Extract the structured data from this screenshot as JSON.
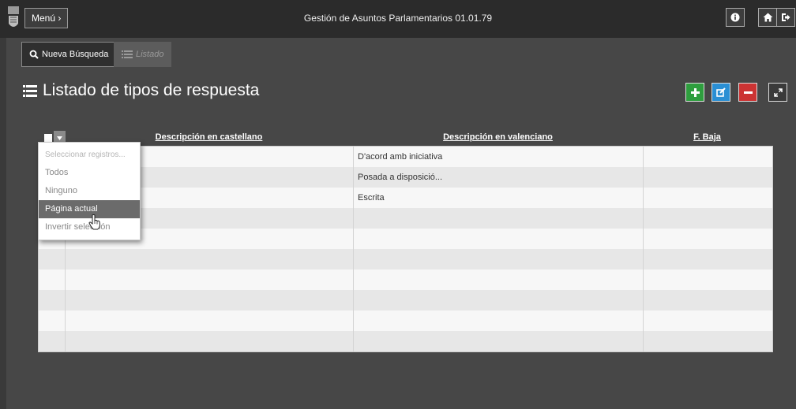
{
  "header": {
    "menu_label": "Menú ›",
    "app_title": "Gestión de Asuntos Parlamentarios 01.01.79"
  },
  "tabs": [
    {
      "label": "Nueva Búsqueda",
      "icon": "search-icon"
    },
    {
      "label": "Listado",
      "icon": "list-icon"
    }
  ],
  "page": {
    "title": "Listado de tipos de respuesta",
    "title_icon": "list-icon"
  },
  "actions": [
    {
      "name": "add",
      "icon": "plus-icon",
      "color": "#2e9e3e"
    },
    {
      "name": "edit",
      "icon": "edit-icon",
      "color": "#2a8fd4"
    },
    {
      "name": "delete",
      "icon": "minus-icon",
      "color": "#cc3333"
    },
    {
      "name": "expand",
      "icon": "expand-icon",
      "color": "#3a3a3a"
    }
  ],
  "grid": {
    "columns": [
      "Descripción en castellano",
      "Descripción en valenciano",
      "F. Baja"
    ],
    "rows": [
      [
        "",
        "D'acord amb iniciativa",
        ""
      ],
      [
        "",
        "Posada a disposició...",
        ""
      ],
      [
        "",
        "Escrita",
        ""
      ],
      [
        "",
        "",
        ""
      ],
      [
        "",
        "",
        ""
      ],
      [
        "",
        "",
        ""
      ],
      [
        "",
        "",
        ""
      ],
      [
        "",
        "",
        ""
      ],
      [
        "",
        "",
        ""
      ],
      [
        "",
        "",
        ""
      ]
    ]
  },
  "selection_menu": {
    "items": [
      "Seleccionar registros...",
      "Todos",
      "Ninguno",
      "Página actual",
      "Invertir selección"
    ],
    "active": "Página actual"
  },
  "colors": {
    "topbar": "#2b2b2b",
    "content_bg": "#474747",
    "add": "#2e9e3e",
    "edit": "#2a8fd4",
    "delete": "#cc3333"
  }
}
